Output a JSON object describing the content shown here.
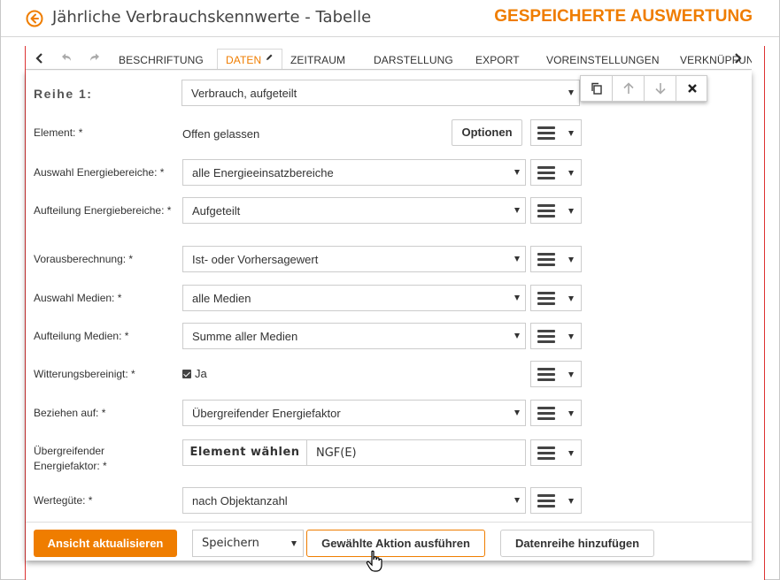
{
  "header": {
    "title": "Jährliche Verbrauchskennwerte - Tabelle",
    "saved_label": "GESPEICHERTE AUSWERTUNG",
    "accent_color": "#ef7d00"
  },
  "tabs": [
    {
      "label": "BESCHRIFTUNG",
      "active": false
    },
    {
      "label": "DATEN",
      "active": true
    },
    {
      "label": "ZEITRAUM",
      "active": false
    },
    {
      "label": "DARSTELLUNG",
      "active": false
    },
    {
      "label": "EXPORT",
      "active": false
    },
    {
      "label": "VOREINSTELLUNGEN",
      "active": false
    },
    {
      "label": "VERKNÜPFUNGEN",
      "active": false
    }
  ],
  "series": {
    "label": "Reihe 1:",
    "value": "Verbrauch, aufgeteilt"
  },
  "rows": [
    {
      "label": "Element: *",
      "value": "Offen gelassen",
      "button": "Optionen"
    },
    {
      "label": "Auswahl Energiebereiche: *",
      "value": "alle Energieeinsatzbereiche"
    },
    {
      "label": "Aufteilung Energiebereiche: *",
      "value": "Aufgeteilt"
    },
    {
      "label": "Vorausberechnung: *",
      "value": "Ist- oder Vorhersagewert"
    },
    {
      "label": "Auswahl Medien: *",
      "value": "alle Medien"
    },
    {
      "label": "Aufteilung Medien: *",
      "value": "Summe aller Medien"
    },
    {
      "label": "Witterungsbereinigt: *",
      "checkbox_label": "Ja",
      "checked": true
    },
    {
      "label": "Beziehen auf: *",
      "value": "Übergreifender Energiefaktor"
    },
    {
      "label": "Übergreifender Energiefaktor: *",
      "button": "Element wählen",
      "value": "NGF(E)"
    },
    {
      "label": "Wertegüte: *",
      "value": "nach Objektanzahl"
    }
  ],
  "footer": {
    "refresh_button": "Ansicht aktualisieren",
    "action_select": "Speichern",
    "execute_button": "Gewählte Aktion ausführen",
    "add_series_button": "Datenreihe hinzufügen"
  }
}
